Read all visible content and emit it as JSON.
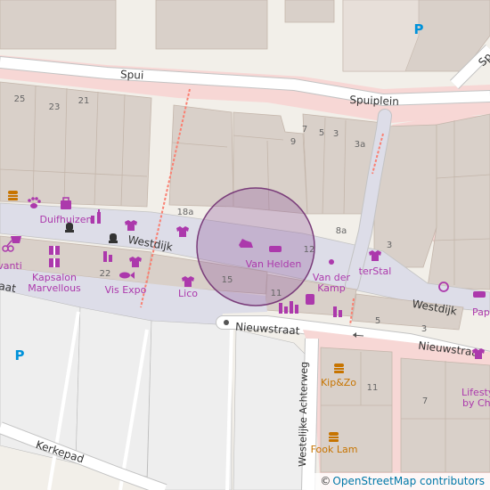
{
  "map": {
    "streets": {
      "spui": "Spui",
      "spuiplein": "Spuiplein",
      "westdijk_left": "Westdijk",
      "westdijk_right": "Westdijk",
      "nieuwstraat_left": "Nieuwstraat",
      "nieuwstraat_right": "Nieuwstraat",
      "kerkepad": "Kerkepad",
      "westelijke_achterweg": "Westelijke Achterweg",
      "top_right_partial": "Sp",
      "left_partial": "aat"
    },
    "house_numbers": [
      "25",
      "23",
      "21",
      "7",
      "5",
      "3",
      "9",
      "3a",
      "18a",
      "12",
      "8a",
      "3",
      "22",
      "15",
      "11",
      "5",
      "3",
      "11",
      "7"
    ],
    "pois": {
      "duifhuizen": "Duifhuizen",
      "kapsalon_1": "Kapsalon",
      "kapsalon_2": "Marvellous",
      "vanti": "vanti",
      "vis_expo": "Vis Expo",
      "lico": "Lico",
      "van_helden": "Van Helden",
      "van_der_kamp_1": "Van der",
      "van_der_kamp_2": "Kamp",
      "terstal": "terStal",
      "papyrus": "Papyru",
      "kip_zo": "Kip&Zo",
      "fook_lam": "Fook Lam",
      "lifestyle_1": "Lifesty",
      "lifestyle_2": "by Chr"
    },
    "parking_symbols": [
      "P",
      "P"
    ],
    "colors": {
      "background": "#f2efe9",
      "building": "#d9d0c9",
      "building_outline": "#c4b6ab",
      "pedestrian": "#dddde8",
      "road_casing": "#c3c3c3",
      "street_white": "#ffffff",
      "pink_area": "#f7d7d5",
      "poi_purple": "#ac39ac",
      "food_orange": "#c77400",
      "parking_blue": "#0092da",
      "highlight_circle": "#7a3d7a",
      "path_red": "#fa8072"
    },
    "icons": [
      "bag-icon",
      "paw-icon",
      "shirt-icon",
      "bottle-icon",
      "candy-icon",
      "fish-icon",
      "toy-horse-icon",
      "shoe-icon",
      "ring-icon",
      "hairdresser-icon",
      "burger-icon",
      "fork-knife-icon",
      "jar-icon",
      "cart-icon",
      "gift-icon",
      "memorial-icon",
      "arrow-left-icon"
    ]
  },
  "attribution": {
    "copyright": "©",
    "link_text": "OpenStreetMap contributors"
  }
}
